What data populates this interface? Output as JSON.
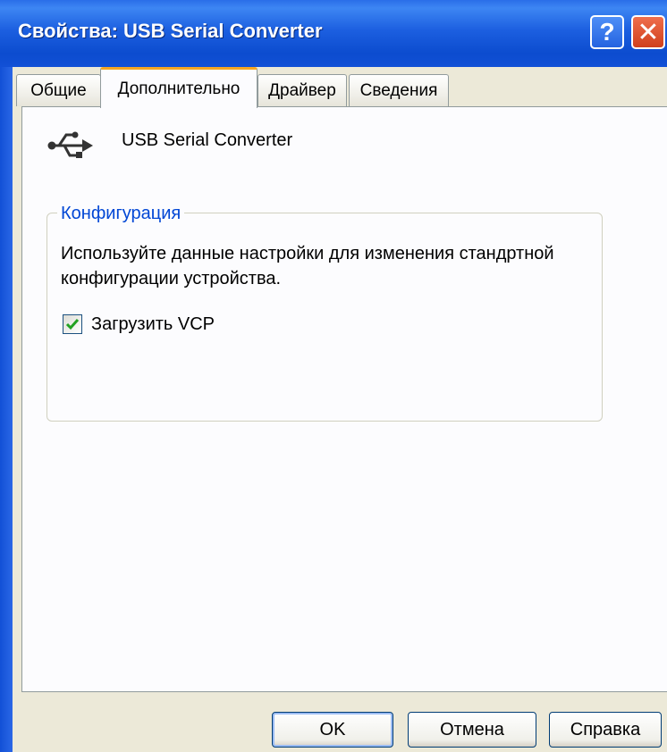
{
  "window": {
    "title": "Свойства: USB Serial Converter",
    "help_glyph": "?",
    "close_glyph": "✕"
  },
  "tabs": [
    {
      "label": "Общие",
      "active": false
    },
    {
      "label": "Дополнительно",
      "active": true
    },
    {
      "label": "Драйвер",
      "active": false
    },
    {
      "label": "Сведения",
      "active": false
    }
  ],
  "device": {
    "icon": "usb-icon",
    "name": "USB Serial Converter"
  },
  "config_group": {
    "legend": "Конфигурация",
    "description": "Используйте данные настройки для изменения стандртной конфигурации устройства.",
    "vcp_checkbox": {
      "label": "Загрузить VCP",
      "checked": true
    }
  },
  "buttons": {
    "ok": "OK",
    "cancel": "Отмена",
    "help": "Справка"
  },
  "colors": {
    "titlebar": "#0c4ccf",
    "dialog_bg": "#ece9d8",
    "panel_bg": "#fcfcfe",
    "active_tab_accent": "#f5a623",
    "group_legend": "#0046d5",
    "checkmark": "#21a121"
  }
}
